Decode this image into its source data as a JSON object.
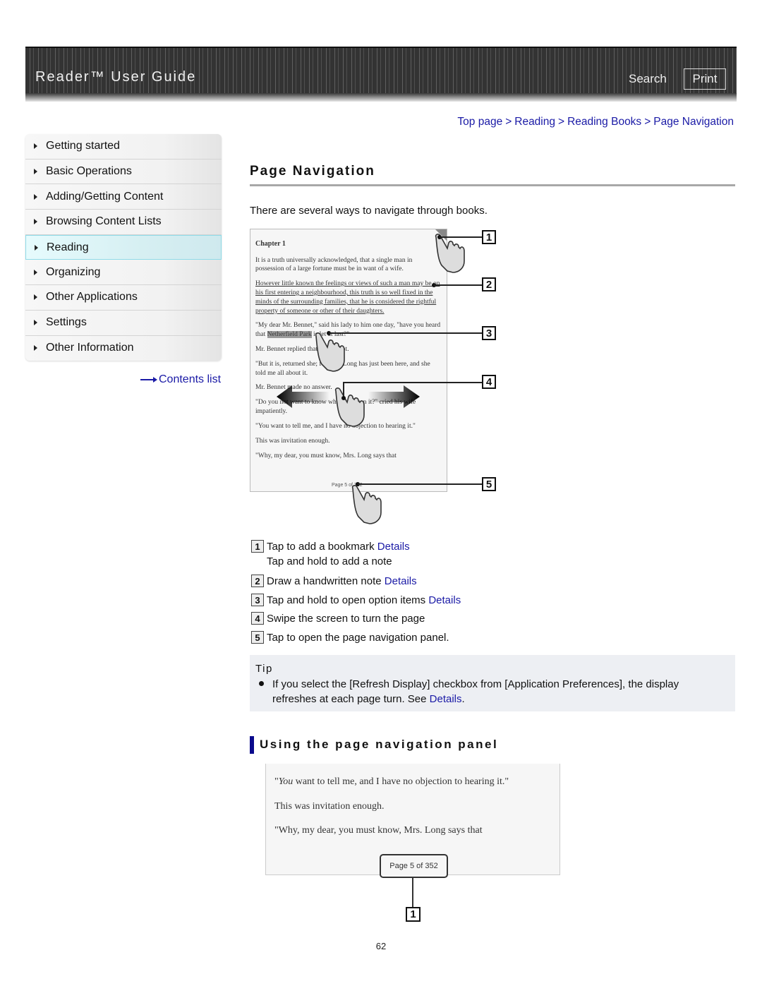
{
  "header": {
    "title": "Reader™ User Guide",
    "search_label": "Search",
    "print_label": "Print"
  },
  "breadcrumb": {
    "items": [
      "Top page",
      "Reading",
      "Reading Books",
      "Page Navigation"
    ],
    "separator": ">"
  },
  "sidebar": {
    "items": [
      {
        "label": "Getting started",
        "active": false
      },
      {
        "label": "Basic Operations",
        "active": false
      },
      {
        "label": "Adding/Getting Content",
        "active": false
      },
      {
        "label": "Browsing Content Lists",
        "active": false
      },
      {
        "label": "Reading",
        "active": true
      },
      {
        "label": "Organizing",
        "active": false
      },
      {
        "label": "Other Applications",
        "active": false
      },
      {
        "label": "Settings",
        "active": false
      },
      {
        "label": "Other Information",
        "active": false
      }
    ],
    "contents_link": "Contents list"
  },
  "main": {
    "title": "Page Navigation",
    "intro": "There are several ways to navigate through books.",
    "figure1": {
      "chapter": "Chapter 1",
      "paragraphs": [
        "It is a truth universally acknowledged, that a single man in possession of a large fortune must be in want of a wife.",
        "However little known the feelings or views of such a man may be on his first entering a neighbourhood, this truth is so well fixed in the minds of the surrounding families, that he is considered the rightful property of someone or other of their daughters.",
        "\"My dear Mr. Bennet,\" said his lady to him one day, \"have you heard that Netherfield Park is let at last?\"",
        "Mr. Bennet replied that he had not.",
        "\"But it is, returned she; for Mrs. Long has just been here, and she told me all about it.",
        "Mr. Bennet made no answer.",
        "\"Do you not want to know who has taken it?\" cried his wife impatiently.",
        "\"You want to tell me, and I have no objection to hearing it.\"",
        "This was invitation enough.",
        "\"Why, my dear, you must know, Mrs. Long says that"
      ],
      "highlight_word": "Netherfield Park",
      "page_indicator": "Page 5 of 352",
      "callouts": [
        "1",
        "2",
        "3",
        "4",
        "5"
      ]
    },
    "legend": [
      {
        "num": "1",
        "text": "Tap to add a bookmark",
        "link": "Details",
        "extra": "Tap and hold to add a note"
      },
      {
        "num": "2",
        "text": "Draw a handwritten note",
        "link": "Details"
      },
      {
        "num": "3",
        "text": "Tap and hold to open option items",
        "link": "Details"
      },
      {
        "num": "4",
        "text": "Swipe the screen to turn the page"
      },
      {
        "num": "5",
        "text": "Tap to open the page navigation panel."
      }
    ],
    "tip": {
      "title": "Tip",
      "text": "If you select the [Refresh Display] checkbox from [Application Preferences], the display refreshes at each page turn. See",
      "link": "Details",
      "end": "."
    },
    "subsection": {
      "title": "Using the page navigation panel",
      "figure2": {
        "lines": [
          "\"You want to tell me, and I have no objection to hearing it.\"",
          "This was invitation enough.",
          "\"Why, my dear, you must know, Mrs. Long says that"
        ],
        "italic_word": "You",
        "page_indicator": "Page 5 of 352",
        "callout": "1"
      }
    }
  },
  "footer": {
    "page_number": "62"
  }
}
